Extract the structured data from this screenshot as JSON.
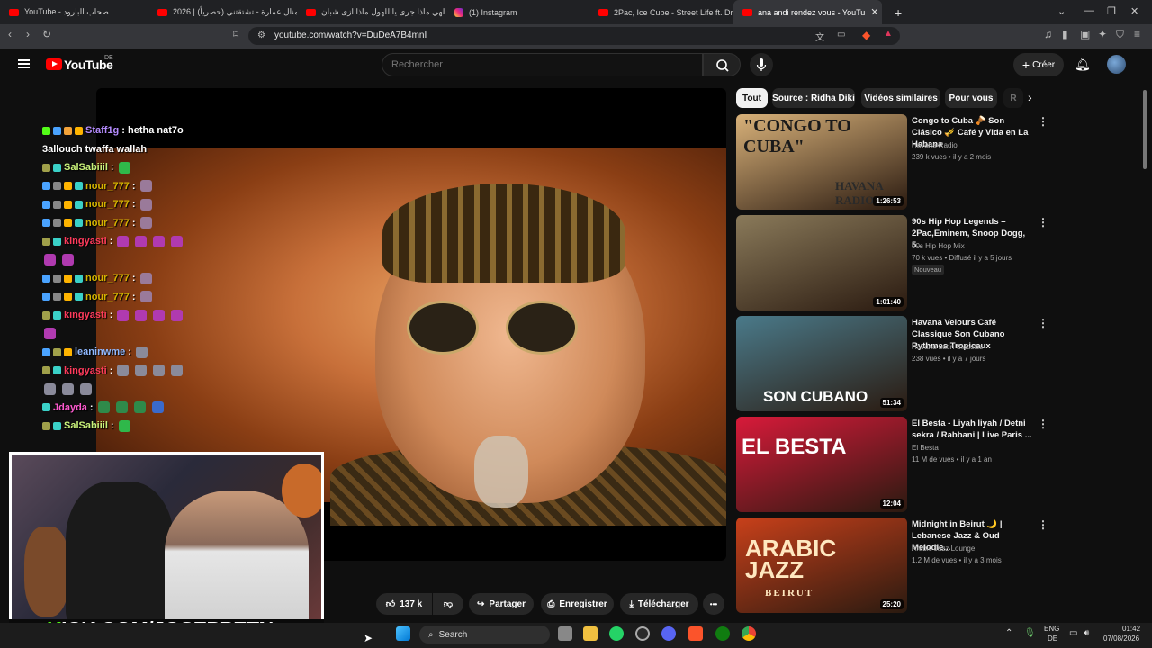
{
  "browser": {
    "tabs": [
      {
        "label": "YouTube - صحاب البارود",
        "type": "yt"
      },
      {
        "label": "2026 | منال عمارة - تشتقتني (حصرياً) |",
        "type": "yt"
      },
      {
        "label": "يا الهي ماذا جرى يااللهول ماذا ازى شبان",
        "type": "yt"
      },
      {
        "label": "(1) Instagram",
        "type": "ig"
      },
      {
        "label": "2Pac, Ice Cube - Street Life ft. Dr Dre",
        "type": "yt"
      },
      {
        "label": "ana andi rendez vous - YouTu",
        "type": "yt",
        "active": true
      }
    ],
    "new_tab": "+",
    "url": "youtube.com/watch?v=DuDeA7B4mnI"
  },
  "youtube": {
    "logo_text": "YouTube",
    "country": "DE",
    "search_placeholder": "Rechercher",
    "create_label": "Créer"
  },
  "chat": [
    {
      "user": "Staff1g",
      "user_color": "#b58cff",
      "msg": ": hetha nat7o",
      "badges": [
        "#53fc18",
        "#4aa3ff",
        "#f3a33a",
        "#ffb400"
      ]
    },
    {
      "user": "",
      "user_color": "#ffffff",
      "msg": "3allouch twaffa wallah",
      "badges": []
    },
    {
      "user": "SalSabiiil",
      "user_color": "#c9f27a",
      "msg": ":",
      "badges": [
        "#a0a04a",
        "#3ad1c8"
      ],
      "emotes": [
        "#2fb84a"
      ]
    },
    {
      "user": "nour_777",
      "user_color": "#d6b400",
      "msg": ":",
      "badges": [
        "#4aa3ff",
        "#888",
        "#ffb400",
        "#3ad1c8"
      ],
      "emotes": [
        "#9a7a9a"
      ]
    },
    {
      "user": "nour_777",
      "user_color": "#d6b400",
      "msg": ":",
      "badges": [
        "#4aa3ff",
        "#888",
        "#ffb400",
        "#3ad1c8"
      ],
      "emotes": [
        "#9a7a9a"
      ]
    },
    {
      "user": "nour_777",
      "user_color": "#d6b400",
      "msg": ":",
      "badges": [
        "#4aa3ff",
        "#888",
        "#ffb400",
        "#3ad1c8"
      ],
      "emotes": [
        "#9a7a9a"
      ]
    },
    {
      "user": "kingyasti",
      "user_color": "#ff3b5c",
      "msg": ":",
      "badges": [
        "#a0a04a",
        "#3ad1c8"
      ],
      "emotes": [
        "#b03ab0",
        "#b03ab0",
        "#b03ab0",
        "#b03ab0"
      ]
    },
    {
      "user": "",
      "user_color": "#ffffff",
      "msg": "",
      "badges": [],
      "emotes": [
        "#b03ab0",
        "#b03ab0"
      ]
    },
    {
      "user": "nour_777",
      "user_color": "#d6b400",
      "msg": ":",
      "badges": [
        "#4aa3ff",
        "#888",
        "#ffb400",
        "#3ad1c8"
      ],
      "emotes": [
        "#9a7a9a"
      ]
    },
    {
      "user": "nour_777",
      "user_color": "#d6b400",
      "msg": ":",
      "badges": [
        "#4aa3ff",
        "#888",
        "#ffb400",
        "#3ad1c8"
      ],
      "emotes": [
        "#9a7a9a"
      ]
    },
    {
      "user": "kingyasti",
      "user_color": "#ff3b5c",
      "msg": ":",
      "badges": [
        "#a0a04a",
        "#3ad1c8"
      ],
      "emotes": [
        "#b03ab0",
        "#b03ab0",
        "#b03ab0",
        "#b03ab0"
      ]
    },
    {
      "user": "",
      "user_color": "#ffffff",
      "msg": "",
      "badges": [],
      "emotes": [
        "#b03ab0"
      ]
    },
    {
      "user": "leaninwme",
      "user_color": "#8fb8ff",
      "msg": ":",
      "badges": [
        "#4aa3ff",
        "#a0a04a",
        "#ffb400"
      ],
      "emotes": [
        "#8a8a9a"
      ]
    },
    {
      "user": "kingyasti",
      "user_color": "#ff3b5c",
      "msg": ":",
      "badges": [
        "#a0a04a",
        "#3ad1c8"
      ],
      "emotes": [
        "#8a8a9a",
        "#8a8a9a",
        "#8a8a9a",
        "#8a8a9a"
      ]
    },
    {
      "user": "",
      "user_color": "#ffffff",
      "msg": "",
      "badges": [],
      "emotes": [
        "#8a8a9a",
        "#8a8a9a",
        "#8a8a9a"
      ]
    },
    {
      "user": "Jdayda",
      "user_color": "#ff5ad0",
      "msg": ":",
      "badges": [
        "#3ad1c8"
      ],
      "emotes": [
        "#2f8a4a",
        "#2f8a4a",
        "#2f8a4a",
        "#3a6acc"
      ]
    },
    {
      "user": "SalSabiiil",
      "user_color": "#c9f27a",
      "msg": ":",
      "badges": [
        "#a0a04a",
        "#3ad1c8"
      ],
      "emotes": [
        "#2fb84a"
      ]
    }
  ],
  "stream_overlay": {
    "kick_prefix": "K",
    "kick_text": "ICK.COM/JOSEPPETN"
  },
  "actions": {
    "likes": "137 k",
    "share": "Partager",
    "save": "Enregistrer",
    "download": "Télécharger",
    "more": "•••"
  },
  "chips": [
    {
      "label": "Tout",
      "active": true
    },
    {
      "label": "Source : Ridha Diki"
    },
    {
      "label": "Vidéos similaires"
    },
    {
      "label": "Pour vous"
    },
    {
      "label": "R"
    }
  ],
  "recommendations": [
    {
      "title": "Congo to Cuba 🪘 Son Clásico 🎺 Café y Vida en La Habana",
      "channel": "Havana Radio",
      "meta": "239 k vues • il y a 2 mois",
      "duration": "1:26:53",
      "thumb_text": "\"CONGO TO CUBA\"",
      "thumb_sub": "HAVANA RADIO",
      "bg": "#d9b27a"
    },
    {
      "title": "90s Hip Hop Legends – 2Pac,Eminem, Snoop Dogg, 5...",
      "channel": "90s Hip Hop Mix",
      "meta": "70 k vues • Diffusé il y a 5 jours",
      "badge": "Nouveau",
      "duration": "1:01:40",
      "thumb_text": "",
      "thumb_sub": "",
      "bg": "#8a7a5a"
    },
    {
      "title": "Havana Velours Café Classique Son Cubano Rythmes Tropicaux",
      "channel": "Havana Latin Classics",
      "meta": "238 vues • il y a 7 jours",
      "duration": "51:34",
      "thumb_text": "SON CUBANO",
      "thumb_sub": "",
      "bg": "#4a7a8a"
    },
    {
      "title": "El Besta - Liyah liyah / Detni sekra / Rabbani | Live Paris ...",
      "channel": "El Besta",
      "meta": "11 M de vues • il y a 1 an",
      "duration": "12:04",
      "thumb_text": "EL BESTA",
      "thumb_sub": "",
      "bg": "#d81a3a"
    },
    {
      "title": "Midnight in Beirut 🌙 | Lebanese Jazz & Oud Melodie...",
      "channel": "Arabic Jazz Lounge",
      "meta": "1,2 M de vues • il y a 3 mois",
      "duration": "25:20",
      "thumb_text": "ARABIC JAZZ",
      "thumb_sub": "BEIRUT",
      "bg": "#c8401a"
    }
  ],
  "taskbar": {
    "search_label": "Search",
    "lang_top": "ENG",
    "lang_bottom": "DE",
    "time": "01:42",
    "date": "07/08/2026"
  }
}
